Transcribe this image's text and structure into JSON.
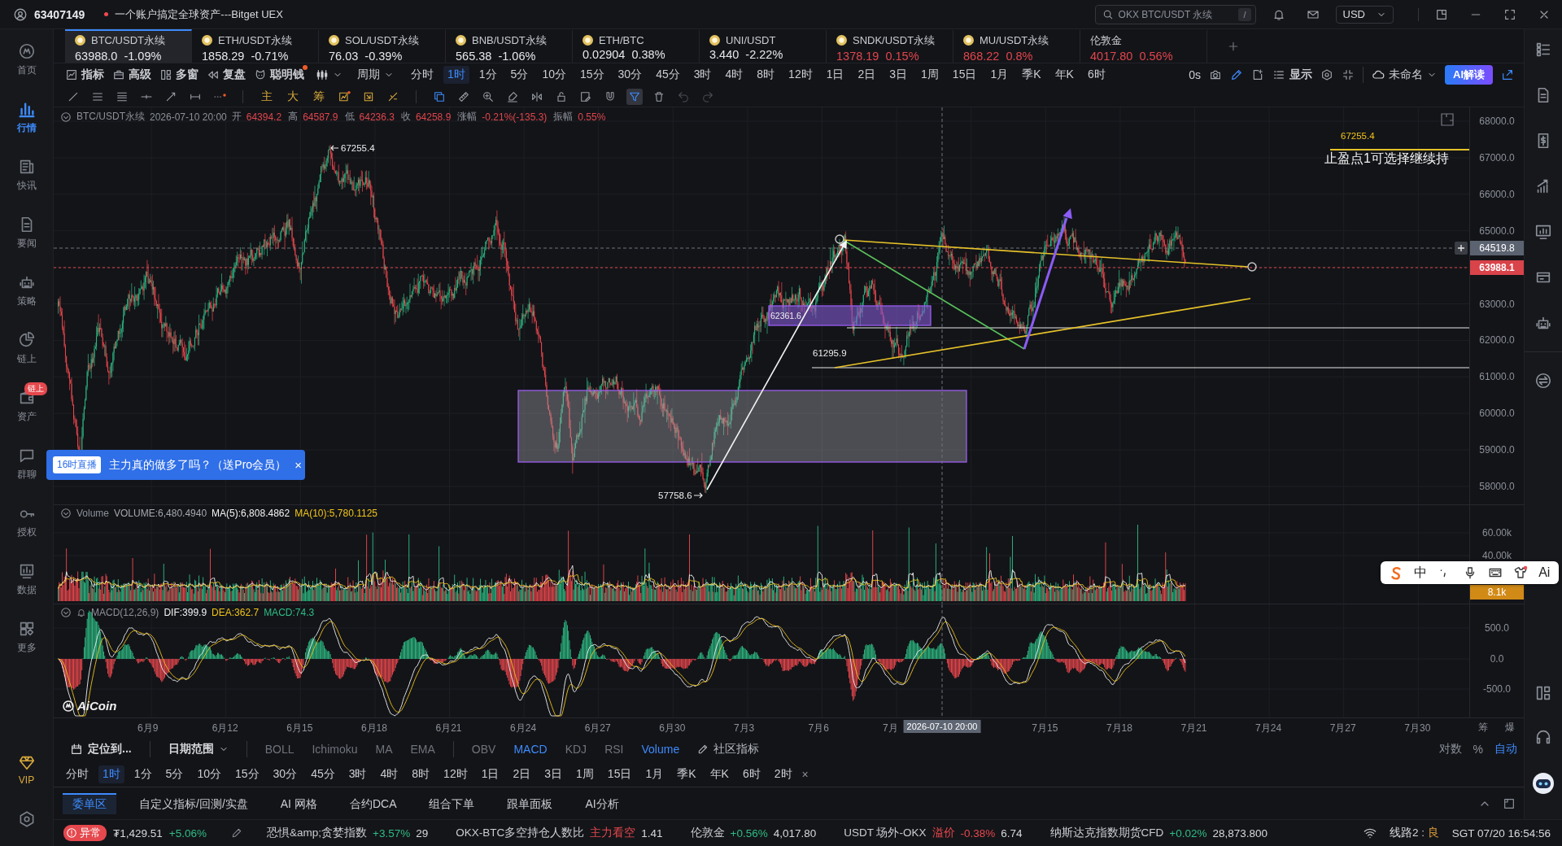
{
  "top_bar": {
    "user_id": "63407149",
    "notice": "一个账户搞定全球资产---Bitget UEX",
    "search": {
      "placeholder": "OKX BTC/USDT 永续",
      "shortcut": "/"
    },
    "currency": "USD"
  },
  "sidebar": {
    "items": [
      {
        "label": "首页",
        "selected": false
      },
      {
        "label": "行情",
        "selected": true
      },
      {
        "label": "快讯",
        "selected": false
      },
      {
        "label": "要闻",
        "selected": false
      },
      {
        "label": "策略",
        "selected": false
      },
      {
        "label": "链上",
        "selected": false
      },
      {
        "label": "资产",
        "selected": false,
        "badge": "链上"
      },
      {
        "label": "群聊",
        "selected": false
      },
      {
        "label": "授权",
        "selected": false
      },
      {
        "label": "数据",
        "selected": false
      },
      {
        "label": "更多",
        "selected": false
      }
    ],
    "vip": "VIP"
  },
  "tickers": [
    {
      "symbol": "BTC/USDT永续",
      "price": "63988.0",
      "change": "-1.09%",
      "color": "#e6e7ea",
      "coin": true,
      "selected": true
    },
    {
      "symbol": "ETH/USDT永续",
      "price": "1858.29",
      "change": "-0.71%",
      "color": "#e6e7ea",
      "coin": true,
      "selected": false
    },
    {
      "symbol": "SOL/USDT永续",
      "price": "76.03",
      "change": "-0.39%",
      "color": "#e6e7ea",
      "coin": true,
      "selected": false
    },
    {
      "symbol": "BNB/USDT永续",
      "price": "565.38",
      "change": "-1.06%",
      "color": "#e6e7ea",
      "coin": true,
      "selected": false
    },
    {
      "symbol": "ETH/BTC",
      "price": "0.02904",
      "change": "0.38%",
      "color": "#e6e7ea",
      "coin": true,
      "selected": false
    },
    {
      "symbol": "UNI/USDT",
      "price": "3.440",
      "change": "-2.22%",
      "color": "#e6e7ea",
      "coin": true,
      "selected": false
    },
    {
      "symbol": "SNDK/USDT永续",
      "price": "1378.19",
      "change": "0.15%",
      "color": "#e0464d",
      "coin": true,
      "selected": false
    },
    {
      "symbol": "MU/USDT永续",
      "price": "868.22",
      "change": "0.8%",
      "color": "#e0464d",
      "coin": true,
      "selected": false
    },
    {
      "symbol": "伦敦金",
      "price": "4017.80",
      "change": "0.56%",
      "color": "#e0464d",
      "coin": false,
      "selected": false
    }
  ],
  "toolbar": {
    "tools": [
      {
        "label": "指标",
        "dot": false
      },
      {
        "label": "高级",
        "dot": false
      },
      {
        "label": "多窗",
        "dot": false
      },
      {
        "label": "复盘",
        "dot": false
      },
      {
        "label": "聪明钱",
        "dot": true
      }
    ],
    "period_menu": "周期",
    "periods": [
      {
        "label": "分时",
        "selected": false
      },
      {
        "label": "1时",
        "selected": true
      },
      {
        "label": "1分",
        "selected": false
      },
      {
        "label": "5分",
        "selected": false
      },
      {
        "label": "10分",
        "selected": false
      },
      {
        "label": "15分",
        "selected": false
      },
      {
        "label": "30分",
        "selected": false
      },
      {
        "label": "45分",
        "selected": false
      },
      {
        "label": "3时",
        "selected": false
      },
      {
        "label": "4时",
        "selected": false
      },
      {
        "label": "8时",
        "selected": false
      },
      {
        "label": "12时",
        "selected": false
      },
      {
        "label": "1日",
        "selected": false
      },
      {
        "label": "2日",
        "selected": false
      },
      {
        "label": "3日",
        "selected": false
      },
      {
        "label": "1周",
        "selected": false
      },
      {
        "label": "15日",
        "selected": false
      },
      {
        "label": "1月",
        "selected": false
      },
      {
        "label": "季K",
        "selected": false
      },
      {
        "label": "年K",
        "selected": false
      },
      {
        "label": "6时",
        "selected": false
      }
    ],
    "countdown": "0s",
    "pen_active": true,
    "display": "显示",
    "layout_name": "未命名",
    "ai_button": "AI解读"
  },
  "draw_toolbar": {
    "glyphs": [
      "主",
      "大",
      "筹"
    ],
    "filter_selected": true
  },
  "chart": {
    "info": {
      "symbol": "BTC/USDT永续",
      "time": "2026-07-10 20:00",
      "fields": [
        {
          "label": "开",
          "value": "64394.2"
        },
        {
          "label": "高",
          "value": "64587.9"
        },
        {
          "label": "低",
          "value": "64236.3"
        },
        {
          "label": "收",
          "value": "64258.9"
        },
        {
          "label": "涨幅",
          "value": "-0.21%(-135.3)"
        },
        {
          "label": "振幅",
          "value": "0.55%"
        }
      ]
    },
    "price_axis": {
      "upper": [
        "68000.0",
        "67000.0",
        "66000.0",
        "65000.0"
      ],
      "crosshair": "64519.8",
      "last": "63988.1",
      "lower": [
        "63000.0",
        "62000.0",
        "61000.0",
        "60000.0",
        "59000.0",
        "58000.0"
      ]
    },
    "peak_label": "67255.4",
    "target_label": "67255.4",
    "target_note": "止盈点1可选择继续持",
    "zone_label": "62361.6",
    "support_label": "61295.9",
    "low_label": "57758.6"
  },
  "volume": {
    "title": "Volume",
    "legend": [
      {
        "text": "VOLUME:6,480.4940",
        "color": "#a3a7ae"
      },
      {
        "text": "MA(5):6,808.4862",
        "color": "#f2f2f2"
      },
      {
        "text": "MA(10):5,780.1125",
        "color": "#f0c419"
      }
    ],
    "ticks": [
      "60.00k",
      "40.00k"
    ],
    "current": "8.1k"
  },
  "macd": {
    "title": "MACD(12,26,9)",
    "legend": [
      {
        "text": "DIF:399.9",
        "color": "#f2f2f2"
      },
      {
        "text": "DEA:362.7",
        "color": "#f0c419"
      },
      {
        "text": "MACD:74.3",
        "color": "#2ebd85"
      }
    ],
    "ticks": [
      "500.0",
      "0.0",
      "-500.0"
    ]
  },
  "chart_logo": "AiCoin",
  "date_axis": {
    "labels": [
      {
        "kind": "date",
        "text": "6月9"
      },
      {
        "kind": "date",
        "text": "6月12"
      },
      {
        "kind": "date",
        "text": "6月15"
      },
      {
        "kind": "date",
        "text": "6月18"
      },
      {
        "kind": "date",
        "text": "6月21"
      },
      {
        "kind": "date",
        "text": "6月24"
      },
      {
        "kind": "date",
        "text": "6月27"
      },
      {
        "kind": "date",
        "text": "6月30"
      },
      {
        "kind": "date",
        "text": "7月3"
      },
      {
        "kind": "date",
        "text": "7月6"
      },
      {
        "kind": "date",
        "text": "7月"
      },
      {
        "kind": "crosshair",
        "text": "2026-07-10 20:00"
      },
      {
        "kind": "date",
        "text": "7月15"
      },
      {
        "kind": "date",
        "text": "7月18"
      },
      {
        "kind": "date",
        "text": "7月21"
      },
      {
        "kind": "date",
        "text": "7月24"
      },
      {
        "kind": "date",
        "text": "7月27"
      },
      {
        "kind": "date",
        "text": "7月30"
      }
    ],
    "right": [
      "筹",
      "爆"
    ]
  },
  "indicator_bar": {
    "locate": "定位到...",
    "date_range": "日期范围",
    "main": [
      {
        "label": "BOLL",
        "selected": false
      },
      {
        "label": "Ichimoku",
        "selected": false
      },
      {
        "label": "MA",
        "selected": false
      },
      {
        "label": "EMA",
        "selected": false
      }
    ],
    "sub": [
      {
        "label": "OBV",
        "selected": false
      },
      {
        "label": "MACD",
        "selected": true
      },
      {
        "label": "KDJ",
        "selected": false
      },
      {
        "label": "RSI",
        "selected": false
      },
      {
        "label": "Volume",
        "selected": true
      }
    ],
    "community": "社区指标",
    "scales": [
      {
        "label": "对数",
        "selected": false
      },
      {
        "label": "%",
        "selected": false
      },
      {
        "label": "自动",
        "selected": true
      }
    ]
  },
  "period_bar": {
    "periods": [
      {
        "label": "分时",
        "selected": false
      },
      {
        "label": "1时",
        "selected": true
      },
      {
        "label": "1分",
        "selected": false
      },
      {
        "label": "5分",
        "selected": false
      },
      {
        "label": "10分",
        "selected": false
      },
      {
        "label": "15分",
        "selected": false
      },
      {
        "label": "30分",
        "selected": false
      },
      {
        "label": "45分",
        "selected": false
      },
      {
        "label": "3时",
        "selected": false
      },
      {
        "label": "4时",
        "selected": false
      },
      {
        "label": "8时",
        "selected": false
      },
      {
        "label": "12时",
        "selected": false
      },
      {
        "label": "1日",
        "selected": false
      },
      {
        "label": "2日",
        "selected": false
      },
      {
        "label": "3日",
        "selected": false
      },
      {
        "label": "1周",
        "selected": false
      },
      {
        "label": "15日",
        "selected": false
      },
      {
        "label": "1月",
        "selected": false
      },
      {
        "label": "季K",
        "selected": false
      },
      {
        "label": "年K",
        "selected": false
      },
      {
        "label": "6时",
        "selected": false
      },
      {
        "label": "2时",
        "selected": false
      }
    ],
    "close": "×"
  },
  "bottom_tabs": [
    {
      "label": "委单区",
      "selected": true
    },
    {
      "label": "自定义指标/回测/实盘",
      "selected": false
    },
    {
      "label": "AI 网格",
      "selected": false
    },
    {
      "label": "合约DCA",
      "selected": false
    },
    {
      "label": "组合下单",
      "selected": false
    },
    {
      "label": "跟单面板",
      "selected": false
    },
    {
      "label": "AI分析",
      "selected": false
    }
  ],
  "status_bar": {
    "alert": "异常",
    "balance": "₮1,429.51",
    "balance_change": {
      "text": "+5.06%",
      "up": true
    },
    "items": [
      {
        "name": "恐惧&amp;贪婪指数",
        "change": "+3.57%",
        "up": true,
        "value": "29"
      },
      {
        "name": "OKX-BTC多空持仓人数比",
        "tag": "主力看空",
        "value": "1.41"
      },
      {
        "name": "伦敦金",
        "change": "+0.56%",
        "up": true,
        "value": "4,017.80"
      },
      {
        "name": "USDT 场外-OKX",
        "tag": "溢价",
        "change": "-0.38%",
        "up": false,
        "value": "6.74"
      },
      {
        "name": "纳斯达克指数期货CFD",
        "change": "+0.02%",
        "up": true,
        "value": "28,873.800"
      }
    ],
    "route": "线路2 :",
    "route_quality": "良",
    "clock": "SGT 07/20 16:54:56"
  },
  "live_banner": {
    "tag": "16时直播",
    "text": "主力真的做多了吗？（送Pro会员）",
    "close": "×"
  },
  "ime_toolbar": {
    "language": "中",
    "ai": "Ai"
  }
}
